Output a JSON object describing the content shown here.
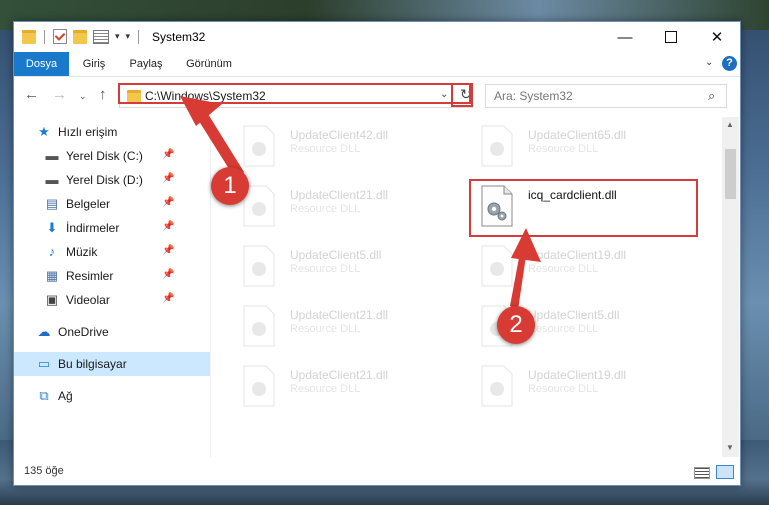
{
  "window": {
    "title": "System32"
  },
  "ribbon": {
    "tabs": [
      "Dosya",
      "Giriş",
      "Paylaş",
      "Görünüm"
    ],
    "help_icon": "?"
  },
  "address": {
    "path": "C:\\Windows\\System32",
    "search_placeholder": "Ara: System32"
  },
  "sidebar": {
    "items": [
      {
        "label": "Hızlı erişim",
        "icon": "star-icon"
      },
      {
        "label": "Yerel Disk (C:)",
        "icon": "drive-icon",
        "pinned": true
      },
      {
        "label": "Yerel Disk (D:)",
        "icon": "drive-icon",
        "pinned": true
      },
      {
        "label": "Belgeler",
        "icon": "document-icon",
        "pinned": true
      },
      {
        "label": "İndirmeler",
        "icon": "download-icon",
        "pinned": true
      },
      {
        "label": "Müzik",
        "icon": "music-icon",
        "pinned": true
      },
      {
        "label": "Resimler",
        "icon": "pictures-icon",
        "pinned": true
      },
      {
        "label": "Videolar",
        "icon": "video-icon",
        "pinned": true
      },
      {
        "label": "OneDrive",
        "icon": "cloud-icon"
      },
      {
        "label": "Bu bilgisayar",
        "icon": "computer-icon",
        "selected": true
      },
      {
        "label": "Ağ",
        "icon": "network-icon"
      }
    ]
  },
  "files": [
    {
      "name": "UpdateClient42.dll",
      "type": "Resource DLL",
      "faded": true
    },
    {
      "name": "UpdateClient65.dll",
      "type": "Resource DLL",
      "faded": true
    },
    {
      "name": "UpdateClient21.dll",
      "type": "Resource DLL",
      "faded": true
    },
    {
      "name": "icq_cardclient.dll",
      "type": "",
      "faded": false
    },
    {
      "name": "UpdateClient5.dll",
      "type": "Resource DLL",
      "faded": true
    },
    {
      "name": "UpdateClient19.dll",
      "type": "Resource DLL",
      "faded": true
    },
    {
      "name": "UpdateClient21.dll",
      "type": "Resource DLL",
      "faded": true
    },
    {
      "name": "UpdateClient5.dll",
      "type": "Resource DLL",
      "faded": true
    },
    {
      "name": "UpdateClient21.dll",
      "type": "Resource DLL",
      "faded": true
    },
    {
      "name": "UpdateClient19.dll",
      "type": "Resource DLL",
      "faded": true
    }
  ],
  "status": {
    "item_count": "135 öğe"
  },
  "annotations": {
    "step1": "1",
    "step2": "2",
    "highlight_color": "#d43b3b"
  }
}
